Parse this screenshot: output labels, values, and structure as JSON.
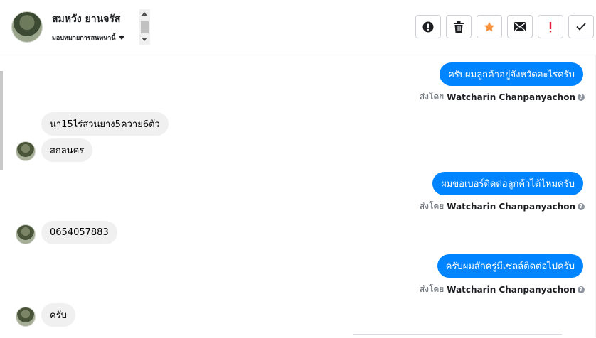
{
  "header": {
    "contact_name": "สมหวัง ยานจรัส",
    "assign_label": "มอบหมายการสนทนานี้",
    "actions": [
      {
        "name": "mark-spam-button",
        "icon": "alert-circle-icon"
      },
      {
        "name": "delete-button",
        "icon": "trash-icon"
      },
      {
        "name": "star-button",
        "icon": "star-icon"
      },
      {
        "name": "mark-unread-button",
        "icon": "envelope-icon"
      },
      {
        "name": "follow-up-button",
        "icon": "exclamation-icon"
      },
      {
        "name": "mark-done-button",
        "icon": "check-icon"
      }
    ]
  },
  "messages": [
    {
      "direction": "out",
      "text": "ครับผมลูกค้าอยู่จังหวัดอะไรครับ",
      "sent_by_prefix": "ส่งโดย",
      "sent_by_name": "Watcharin Chanpanyachon"
    },
    {
      "direction": "in",
      "text": "นา15ไร่สวนยาง5ควาย6ตัว"
    },
    {
      "direction": "in",
      "text": "สกลนคร"
    },
    {
      "direction": "out",
      "text": "ผมขอเบอร์ติดต่อลูกค้าได้ไหมครับ",
      "sent_by_prefix": "ส่งโดย",
      "sent_by_name": "Watcharin Chanpanyachon"
    },
    {
      "direction": "in",
      "text": "0654057883"
    },
    {
      "direction": "out",
      "text": "ครับผมสักครู่มีเซลล์ติดต่อไปครับ",
      "sent_by_prefix": "ส่งโดย",
      "sent_by_name": "Watcharin Chanpanyachon"
    },
    {
      "direction": "in",
      "text": "ครับ"
    }
  ],
  "help_glyph": "?",
  "colors": {
    "outgoing": "#0084ff",
    "incoming": "#f0f0f0",
    "star": "#f7923b",
    "follow_up": "#e41e3f"
  }
}
